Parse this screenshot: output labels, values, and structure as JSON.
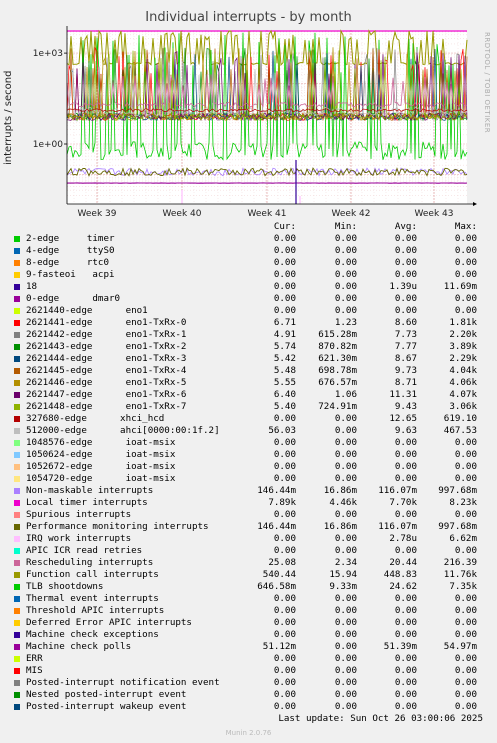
{
  "chart_data": {
    "type": "line",
    "title": "Individual interrupts - by month",
    "ylabel": "interrupts / second",
    "yscale": "log",
    "y_ticks": [
      "1e+03",
      "1e+00",
      "1e-03"
    ],
    "x_ticks": [
      "Week 39",
      "Week 40",
      "Week 41",
      "Week 42",
      "Week 43"
    ],
    "legend_headers": [
      "Cur:",
      "Min:",
      "Avg:",
      "Max:"
    ],
    "series": [
      {
        "name": "2-edge     timer",
        "color": "#00cc00",
        "cur": "0.00",
        "min": "0.00",
        "avg": "0.00",
        "max": "0.00"
      },
      {
        "name": "4-edge     ttyS0",
        "color": "#0066b3",
        "cur": "0.00",
        "min": "0.00",
        "avg": "0.00",
        "max": "0.00"
      },
      {
        "name": "8-edge     rtc0",
        "color": "#ff8000",
        "cur": "0.00",
        "min": "0.00",
        "avg": "0.00",
        "max": "0.00"
      },
      {
        "name": "9-fasteoi   acpi",
        "color": "#ffcc00",
        "cur": "0.00",
        "min": "0.00",
        "avg": "0.00",
        "max": "0.00"
      },
      {
        "name": "18",
        "color": "#330099",
        "cur": "0.00",
        "min": "0.00",
        "avg": "1.39u",
        "max": "11.69m"
      },
      {
        "name": "0-edge      dmar0",
        "color": "#990099",
        "cur": "0.00",
        "min": "0.00",
        "avg": "0.00",
        "max": "0.00"
      },
      {
        "name": "2621440-edge      eno1",
        "color": "#ccff00",
        "cur": "0.00",
        "min": "0.00",
        "avg": "0.00",
        "max": "0.00"
      },
      {
        "name": "2621441-edge      eno1-TxRx-0",
        "color": "#ff0000",
        "cur": "6.71",
        "min": "1.23",
        "avg": "8.60",
        "max": "1.81k"
      },
      {
        "name": "2621442-edge      eno1-TxRx-1",
        "color": "#808080",
        "cur": "4.91",
        "min": "615.28m",
        "avg": "7.73",
        "max": "2.20k"
      },
      {
        "name": "2621443-edge      eno1-TxRx-2",
        "color": "#008f00",
        "cur": "5.74",
        "min": "870.82m",
        "avg": "7.77",
        "max": "3.89k"
      },
      {
        "name": "2621444-edge      eno1-TxRx-3",
        "color": "#00487d",
        "cur": "5.42",
        "min": "621.30m",
        "avg": "8.67",
        "max": "2.29k"
      },
      {
        "name": "2621445-edge      eno1-TxRx-4",
        "color": "#b35a00",
        "cur": "5.48",
        "min": "698.78m",
        "avg": "9.73",
        "max": "4.04k"
      },
      {
        "name": "2621446-edge      eno1-TxRx-5",
        "color": "#b38f00",
        "cur": "5.55",
        "min": "676.57m",
        "avg": "8.71",
        "max": "4.06k"
      },
      {
        "name": "2621447-edge      eno1-TxRx-6",
        "color": "#6b006b",
        "cur": "6.40",
        "min": "1.06",
        "avg": "11.31",
        "max": "4.07k"
      },
      {
        "name": "2621448-edge      eno1-TxRx-7",
        "color": "#8fb300",
        "cur": "5.40",
        "min": "724.91m",
        "avg": "9.43",
        "max": "3.06k"
      },
      {
        "name": "327680-edge      xhci_hcd",
        "color": "#b30000",
        "cur": "0.00",
        "min": "0.00",
        "avg": "12.65",
        "max": "619.10"
      },
      {
        "name": "512000-edge      ahci[0000:00:1f.2]",
        "color": "#bebebe",
        "cur": "56.03",
        "min": "0.00",
        "avg": "9.63",
        "max": "467.53"
      },
      {
        "name": "1048576-edge      ioat-msix",
        "color": "#80ff80",
        "cur": "0.00",
        "min": "0.00",
        "avg": "0.00",
        "max": "0.00"
      },
      {
        "name": "1050624-edge      ioat-msix",
        "color": "#80c9ff",
        "cur": "0.00",
        "min": "0.00",
        "avg": "0.00",
        "max": "0.00"
      },
      {
        "name": "1052672-edge      ioat-msix",
        "color": "#ffc080",
        "cur": "0.00",
        "min": "0.00",
        "avg": "0.00",
        "max": "0.00"
      },
      {
        "name": "1054720-edge      ioat-msix",
        "color": "#ffe680",
        "cur": "0.00",
        "min": "0.00",
        "avg": "0.00",
        "max": "0.00"
      },
      {
        "name": "Non-maskable interrupts",
        "color": "#aa80ff",
        "cur": "146.44m",
        "min": "16.86m",
        "avg": "116.07m",
        "max": "997.68m"
      },
      {
        "name": "Local timer interrupts",
        "color": "#ee00cc",
        "cur": "7.89k",
        "min": "4.46k",
        "avg": "7.70k",
        "max": "8.23k"
      },
      {
        "name": "Spurious interrupts",
        "color": "#ff8080",
        "cur": "0.00",
        "min": "0.00",
        "avg": "0.00",
        "max": "0.00"
      },
      {
        "name": "Performance monitoring interrupts",
        "color": "#666600",
        "cur": "146.44m",
        "min": "16.86m",
        "avg": "116.07m",
        "max": "997.68m"
      },
      {
        "name": "IRQ work interrupts",
        "color": "#ffbfff",
        "cur": "0.00",
        "min": "0.00",
        "avg": "2.78u",
        "max": "6.62m"
      },
      {
        "name": "APIC ICR read retries",
        "color": "#00ffcc",
        "cur": "0.00",
        "min": "0.00",
        "avg": "0.00",
        "max": "0.00"
      },
      {
        "name": "Rescheduling interrupts",
        "color": "#cc6699",
        "cur": "25.08",
        "min": "2.34",
        "avg": "20.44",
        "max": "216.39"
      },
      {
        "name": "Function call interrupts",
        "color": "#999900",
        "cur": "540.44",
        "min": "15.94",
        "avg": "448.83",
        "max": "11.76k"
      },
      {
        "name": "TLB shootdowns",
        "color": "#00cc00",
        "cur": "646.58m",
        "min": "9.33m",
        "avg": "24.62",
        "max": "7.35k"
      },
      {
        "name": "Thermal event interrupts",
        "color": "#0066b3",
        "cur": "0.00",
        "min": "0.00",
        "avg": "0.00",
        "max": "0.00"
      },
      {
        "name": "Threshold APIC interrupts",
        "color": "#ff8000",
        "cur": "0.00",
        "min": "0.00",
        "avg": "0.00",
        "max": "0.00"
      },
      {
        "name": "Deferred Error APIC interrupts",
        "color": "#ffcc00",
        "cur": "0.00",
        "min": "0.00",
        "avg": "0.00",
        "max": "0.00"
      },
      {
        "name": "Machine check exceptions",
        "color": "#330099",
        "cur": "0.00",
        "min": "0.00",
        "avg": "0.00",
        "max": "0.00"
      },
      {
        "name": "Machine check polls",
        "color": "#990099",
        "cur": "51.12m",
        "min": "0.00",
        "avg": "51.39m",
        "max": "54.97m"
      },
      {
        "name": "ERR",
        "color": "#ccff00",
        "cur": "0.00",
        "min": "0.00",
        "avg": "0.00",
        "max": "0.00"
      },
      {
        "name": "MIS",
        "color": "#ff0000",
        "cur": "0.00",
        "min": "0.00",
        "avg": "0.00",
        "max": "0.00"
      },
      {
        "name": "Posted-interrupt notification event",
        "color": "#808080",
        "cur": "0.00",
        "min": "0.00",
        "avg": "0.00",
        "max": "0.00"
      },
      {
        "name": "Nested posted-interrupt event",
        "color": "#008f00",
        "cur": "0.00",
        "min": "0.00",
        "avg": "0.00",
        "max": "0.00"
      },
      {
        "name": "Posted-interrupt wakeup event",
        "color": "#00487d",
        "cur": "0.00",
        "min": "0.00",
        "avg": "0.00",
        "max": "0.00"
      }
    ]
  },
  "side_label": "RRDTOOL / TOBI OETIKER",
  "last_update": "Last update: Sun Oct 26 03:00:06 2025",
  "munin_version": "Munin 2.0.76"
}
